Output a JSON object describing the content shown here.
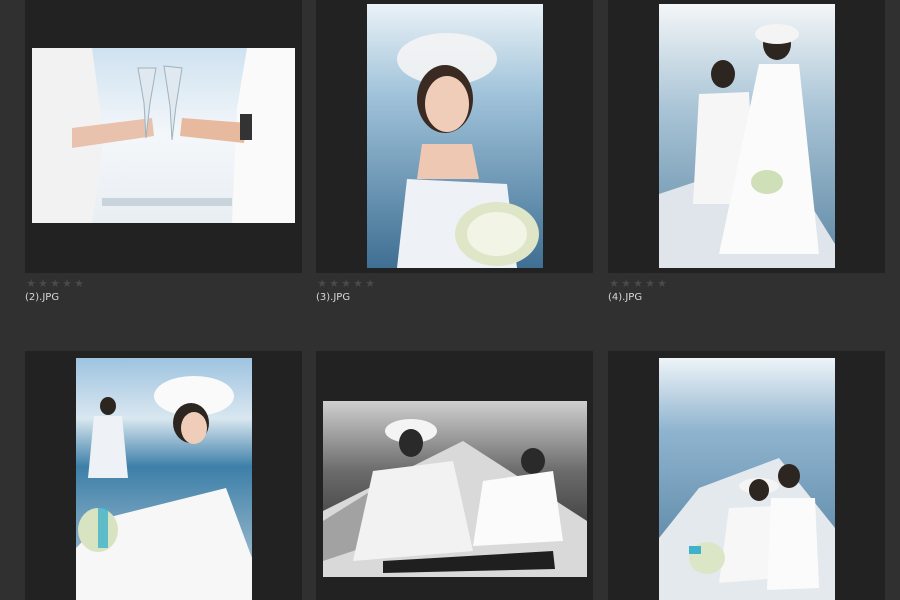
{
  "grid": {
    "items": [
      {
        "filename": "(2).JPG",
        "rating": 0,
        "image": "toast-with-champagne-glasses-photo"
      },
      {
        "filename": "(3).JPG",
        "rating": 0,
        "image": "bride-with-bouquet-portrait-photo"
      },
      {
        "filename": "(4).JPG",
        "rating": 0,
        "image": "couple-on-boat-bow-photo"
      },
      {
        "filename": "",
        "rating": 0,
        "image": "bride-in-hat-seated-photo"
      },
      {
        "filename": "",
        "rating": 0,
        "image": "black-and-white-couple-on-deck-photo"
      },
      {
        "filename": "",
        "rating": 0,
        "image": "couple-sitting-on-yacht-photo"
      }
    ]
  },
  "icons": {
    "star": "star-icon"
  },
  "colors": {
    "background": "#303030",
    "card": "#222222",
    "star_off": "#4a4a4a",
    "text": "#d8d8d8"
  }
}
